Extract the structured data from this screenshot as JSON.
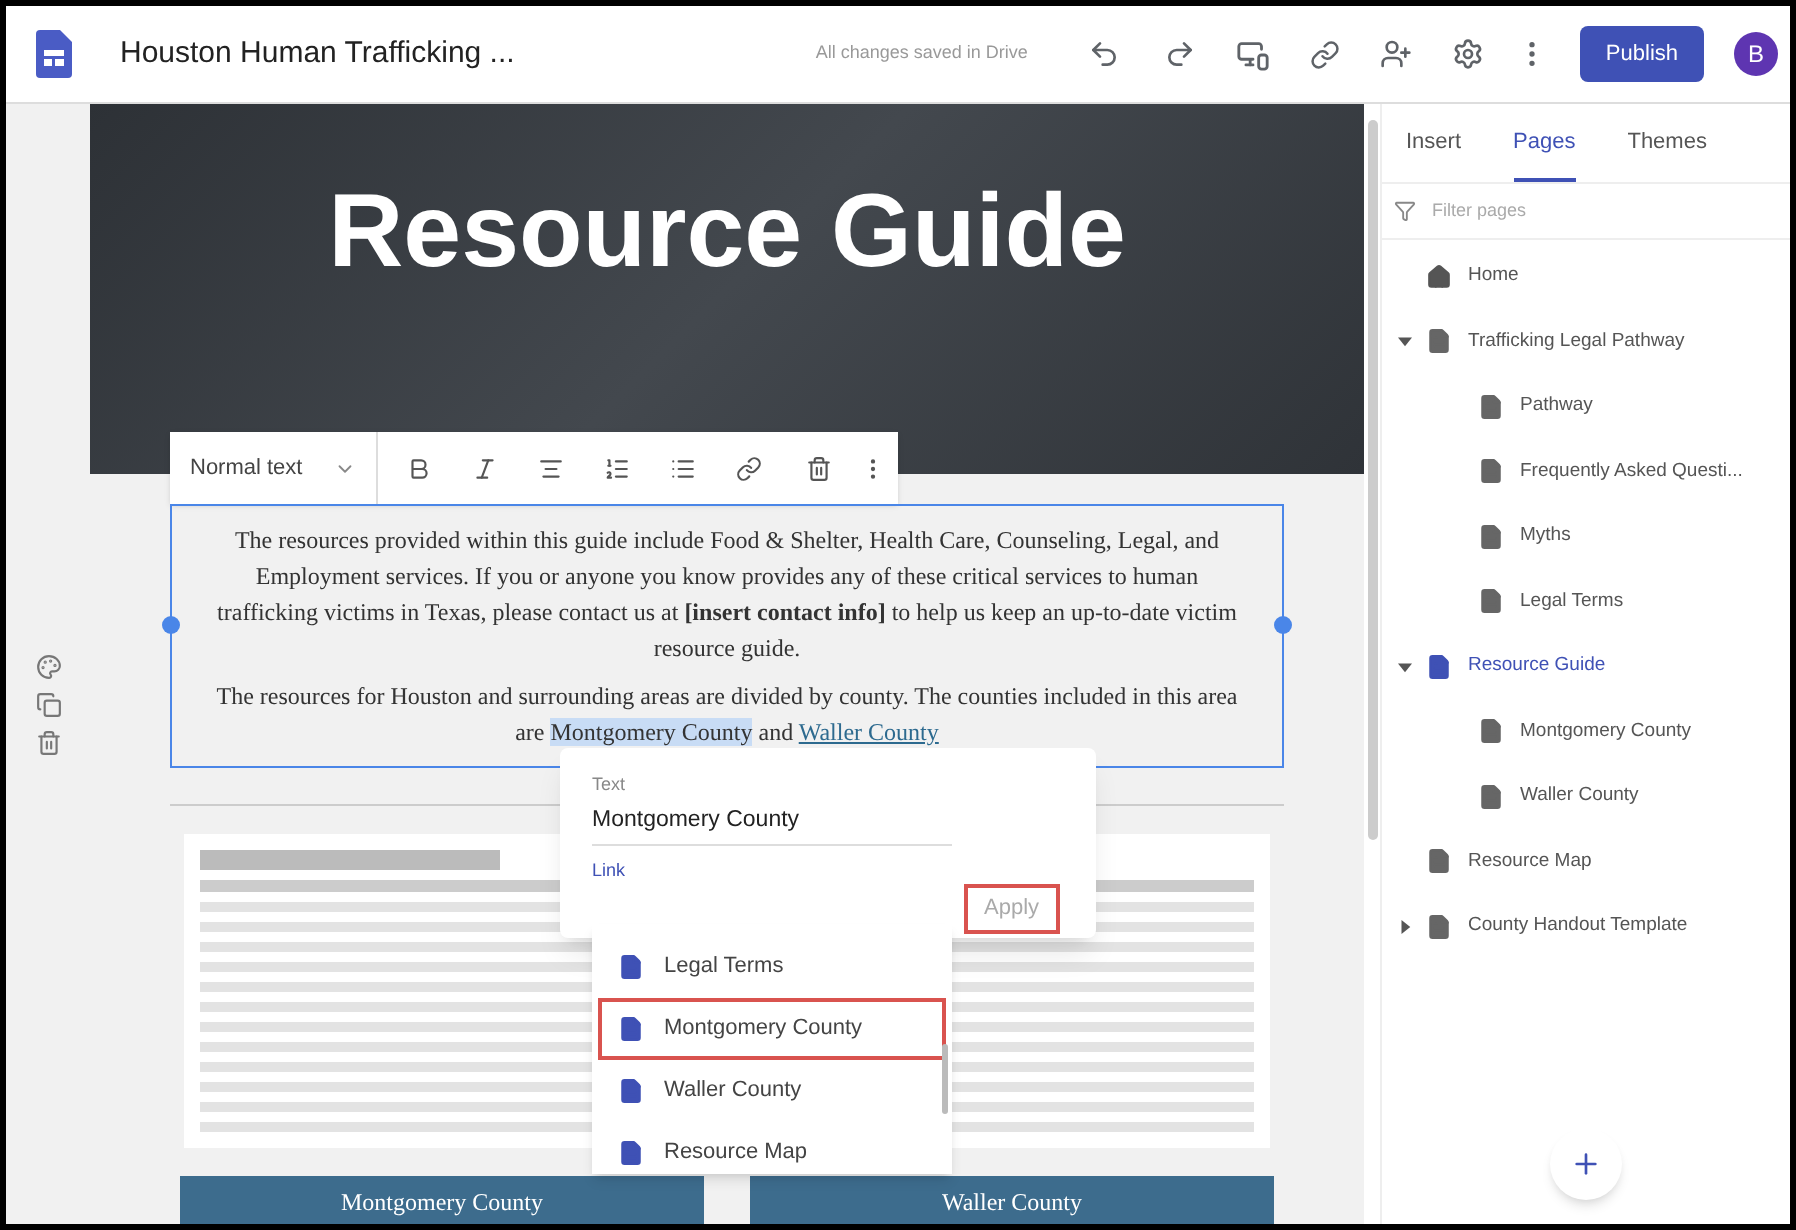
{
  "header": {
    "title": "Houston Human Trafficking ...",
    "save_status": "All changes saved in Drive",
    "publish": "Publish",
    "avatar": "B"
  },
  "banner": {
    "title": "Resource Guide"
  },
  "toolbar": {
    "style": "Normal text"
  },
  "text_box": {
    "paragraph_1": "The resources provided within this guide include Food & Shelter, Health Care, Counseling, Legal, and Employment services. If you or anyone you know provides any of these critical services to human trafficking victims in Texas, please contact us at **[insert contact info]** to help us keep an up-to-date victim resource guide.",
    "paragraph_2": [
      {
        "kind": "plain",
        "text": "The resources for Houston and surrounding areas are divided by county. The counties included in this area are "
      },
      {
        "kind": "selection",
        "text": "Montgomery County"
      },
      {
        "kind": "plain",
        "text": " and "
      },
      {
        "kind": "link",
        "text": "Waller County"
      }
    ]
  },
  "link_popup": {
    "text_label": "Text",
    "text_value": "Montgomery County",
    "link_label": "Link",
    "apply": "Apply",
    "suggestions": [
      {
        "label": "Legal Terms",
        "selected": false
      },
      {
        "label": "Montgomery County",
        "selected": true
      },
      {
        "label": "Waller County",
        "selected": false
      },
      {
        "label": "Resource Map",
        "selected": false
      }
    ]
  },
  "buttons": [
    "Montgomery County",
    "Waller County"
  ],
  "sidebar": {
    "tabs": [
      {
        "label": "Insert",
        "selected": false
      },
      {
        "label": "Pages",
        "selected": true
      },
      {
        "label": "Themes",
        "selected": false
      }
    ],
    "filter": {
      "placeholder": "Filter pages"
    },
    "pages": [
      {
        "label": "Home",
        "kind": "home",
        "selected": false
      },
      {
        "label": "Trafficking Legal Pathway",
        "kind": "page",
        "selected": false,
        "expanded": true,
        "children": [
          {
            "label": "Pathway",
            "kind": "page",
            "selected": false
          },
          {
            "label": "Frequently Asked Questi...",
            "kind": "page",
            "selected": false
          },
          {
            "label": "Myths",
            "kind": "page",
            "selected": false
          },
          {
            "label": "Legal Terms",
            "kind": "page",
            "selected": false
          }
        ]
      },
      {
        "label": "Resource Guide",
        "kind": "page",
        "selected": true,
        "expanded": true,
        "children": [
          {
            "label": "Montgomery County",
            "kind": "page",
            "selected": false
          },
          {
            "label": "Waller County",
            "kind": "page",
            "selected": false
          }
        ]
      },
      {
        "label": "Resource Map",
        "kind": "page",
        "selected": false
      },
      {
        "label": "County Handout Template",
        "kind": "page",
        "selected": false,
        "expanded": false
      }
    ]
  }
}
